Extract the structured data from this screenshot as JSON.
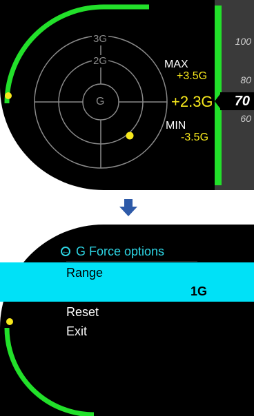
{
  "gforce_screen": {
    "scale_labels": {
      "outer": "3G",
      "middle": "2G",
      "center": "G"
    },
    "max": {
      "label": "MAX",
      "value": "+3.5G"
    },
    "current_value": "+2.3G",
    "min": {
      "label": "MIN",
      "value": "-3.5G"
    },
    "colors": {
      "accent_green": "#22e02a",
      "value_yellow": "#f7e81c"
    }
  },
  "speed_scale": {
    "ticks": [
      "100",
      "80",
      "60"
    ],
    "current": "70"
  },
  "transition": {
    "arrow_icon": "down-arrow-icon",
    "color": "#2e5aa8"
  },
  "options_menu": {
    "title": "G Force options",
    "title_icon": "back-circle-icon",
    "items": [
      {
        "label": "Range",
        "value": "1G",
        "selected": true
      },
      {
        "label": "Reset",
        "selected": false
      },
      {
        "label": "Exit",
        "selected": false
      }
    ],
    "colors": {
      "highlight": "#00e1f7",
      "title": "#2dd4e3"
    }
  }
}
